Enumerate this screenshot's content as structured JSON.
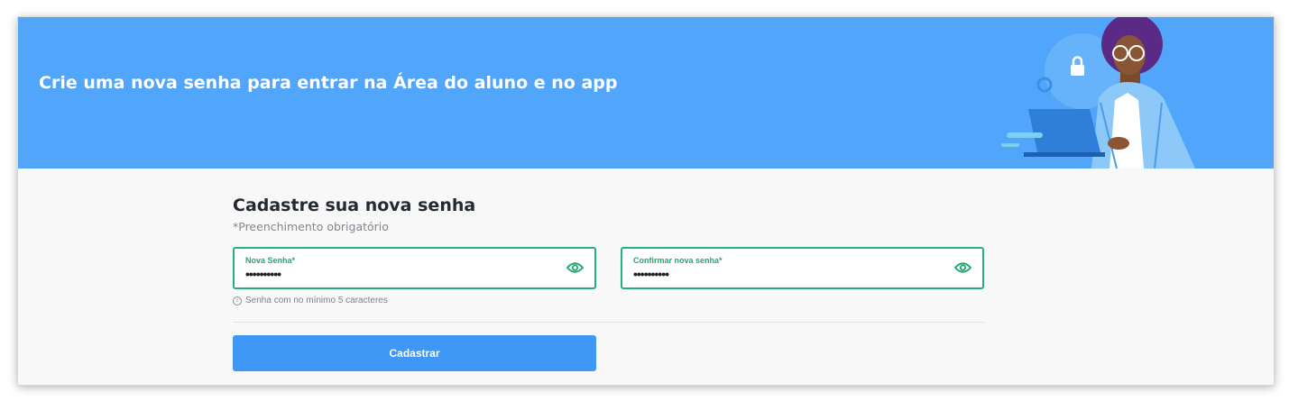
{
  "banner": {
    "title": "Crie uma nova senha para entrar na Área do aluno e no app"
  },
  "form": {
    "title": "Cadastre sua nova senha",
    "required_note": "*Preenchimento obrigatório",
    "new_password": {
      "label": "Nova Senha*",
      "value": "••••••••••"
    },
    "confirm_password": {
      "label": "Confirmar nova senha*",
      "value": "••••••••••"
    },
    "hint": "Senha com no mínimo 5 caracteres",
    "submit_label": "Cadastrar"
  },
  "colors": {
    "banner": "#51a6fb",
    "field_border": "#23b07a",
    "button": "#3f97f6"
  },
  "icons": {
    "password_toggle": "eye-icon",
    "hint": "info-icon",
    "illustration_badge": "lock-icon"
  }
}
